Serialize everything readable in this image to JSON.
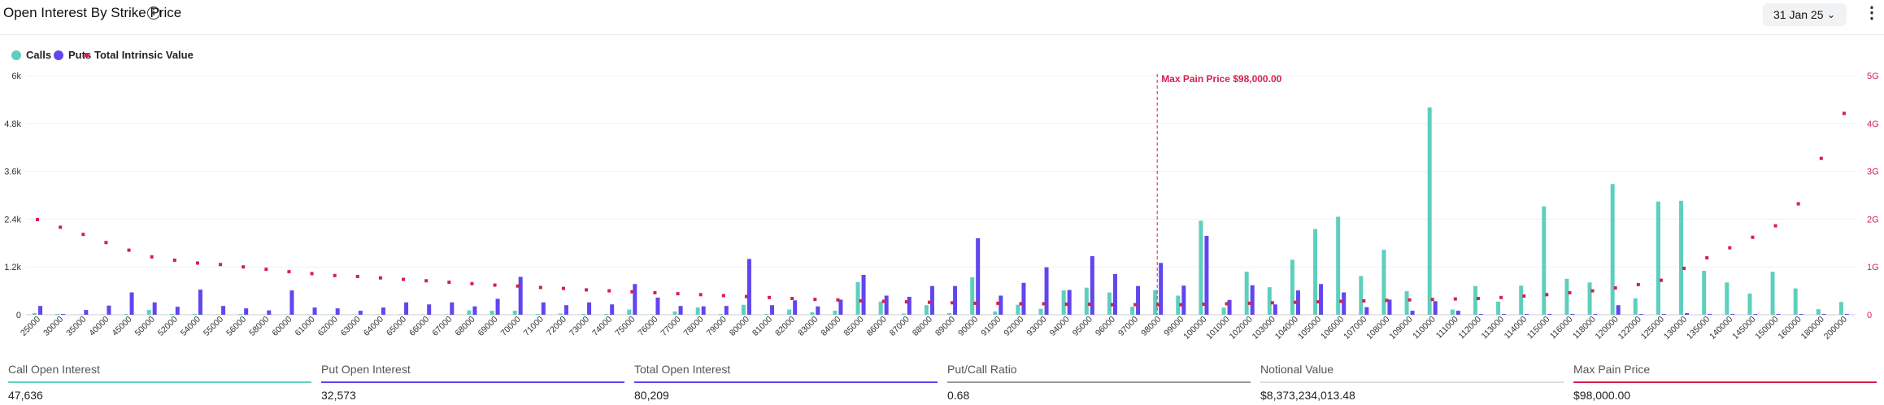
{
  "header": {
    "title": "Open Interest By Strike Price",
    "info_icon": "i",
    "date": "31 Jan 25",
    "chevron_icon": "⌄",
    "more_icon": "⋮"
  },
  "legend": [
    {
      "label": "Calls",
      "color": "#5ecfbd",
      "shape": "circle"
    },
    {
      "label": "Puts",
      "color": "#6146ee",
      "shape": "circle"
    },
    {
      "label": "Total Intrinsic Value",
      "color": "#d61f4f",
      "shape": "square"
    }
  ],
  "stats": [
    {
      "label": "Call Open Interest",
      "value": "47,636",
      "color": "#5ecfbd"
    },
    {
      "label": "Put Open Interest",
      "value": "32,573",
      "color": "#6146ee"
    },
    {
      "label": "Total Open Interest",
      "value": "80,209",
      "color": "#6146ee"
    },
    {
      "label": "Put/Call Ratio",
      "value": "0.68",
      "color": "#999999"
    },
    {
      "label": "Notional Value",
      "value": "$8,373,234,013.48",
      "color": "#dddddd"
    },
    {
      "label": "Max Pain Price",
      "value": "$98,000.00",
      "color": "#d61f4f"
    }
  ],
  "chart_data": {
    "type": "bar",
    "categories": [
      "25000",
      "30000",
      "35000",
      "40000",
      "45000",
      "50000",
      "52000",
      "54000",
      "55000",
      "56000",
      "58000",
      "60000",
      "61000",
      "62000",
      "63000",
      "64000",
      "65000",
      "66000",
      "67000",
      "68000",
      "69000",
      "70000",
      "71000",
      "72000",
      "73000",
      "74000",
      "75000",
      "76000",
      "77000",
      "78000",
      "79000",
      "80000",
      "81000",
      "82000",
      "83000",
      "84000",
      "85000",
      "86000",
      "87000",
      "88000",
      "89000",
      "90000",
      "91000",
      "92000",
      "93000",
      "94000",
      "95000",
      "96000",
      "97000",
      "98000",
      "99000",
      "100000",
      "101000",
      "102000",
      "103000",
      "104000",
      "105000",
      "106000",
      "107000",
      "108000",
      "109000",
      "110000",
      "111000",
      "112000",
      "113000",
      "114000",
      "115000",
      "116000",
      "118000",
      "120000",
      "122000",
      "125000",
      "130000",
      "135000",
      "140000",
      "145000",
      "150000",
      "160000",
      "180000",
      "200000"
    ],
    "series": [
      {
        "name": "Calls",
        "axis": "left",
        "values": [
          40,
          20,
          10,
          10,
          20,
          120,
          20,
          20,
          10,
          20,
          10,
          10,
          10,
          10,
          10,
          10,
          10,
          10,
          10,
          110,
          100,
          100,
          20,
          30,
          20,
          20,
          130,
          10,
          80,
          180,
          20,
          250,
          20,
          130,
          60,
          100,
          820,
          330,
          30,
          240,
          40,
          940,
          80,
          250,
          150,
          610,
          680,
          560,
          200,
          620,
          480,
          2360,
          180,
          1080,
          690,
          1380,
          2150,
          2460,
          970,
          1630,
          590,
          5200,
          130,
          720,
          330,
          730,
          2720,
          900,
          810,
          3280,
          410,
          2840,
          2860,
          1100,
          810,
          530,
          1080,
          660,
          140,
          320
        ]
      },
      {
        "name": "Puts",
        "axis": "left",
        "values": [
          220,
          20,
          120,
          230,
          560,
          310,
          200,
          630,
          220,
          160,
          110,
          610,
          180,
          160,
          100,
          180,
          310,
          260,
          310,
          210,
          400,
          950,
          310,
          240,
          310,
          260,
          770,
          430,
          220,
          210,
          220,
          1400,
          240,
          360,
          210,
          380,
          1000,
          480,
          450,
          720,
          720,
          1920,
          480,
          800,
          1190,
          620,
          1470,
          1020,
          720,
          1300,
          730,
          1980,
          370,
          740,
          260,
          610,
          770,
          560,
          190,
          380,
          100,
          340,
          100,
          20,
          20,
          20,
          20,
          20,
          20,
          240,
          20,
          20,
          40,
          20,
          20,
          20,
          20,
          20,
          20,
          20
        ]
      },
      {
        "name": "Total Intrinsic Value",
        "axis": "right",
        "values": [
          1.99,
          1.83,
          1.68,
          1.51,
          1.35,
          1.21,
          1.14,
          1.08,
          1.05,
          1.0,
          0.95,
          0.9,
          0.86,
          0.82,
          0.8,
          0.77,
          0.74,
          0.71,
          0.68,
          0.65,
          0.62,
          0.6,
          0.57,
          0.55,
          0.52,
          0.5,
          0.48,
          0.46,
          0.44,
          0.42,
          0.4,
          0.38,
          0.36,
          0.34,
          0.32,
          0.31,
          0.29,
          0.28,
          0.27,
          0.26,
          0.25,
          0.24,
          0.24,
          0.23,
          0.23,
          0.22,
          0.22,
          0.21,
          0.21,
          0.21,
          0.21,
          0.22,
          0.23,
          0.24,
          0.25,
          0.26,
          0.27,
          0.28,
          0.29,
          0.3,
          0.31,
          0.32,
          0.33,
          0.34,
          0.36,
          0.39,
          0.42,
          0.46,
          0.5,
          0.56,
          0.63,
          0.72,
          0.97,
          1.19,
          1.4,
          1.62,
          1.86,
          2.32,
          3.27,
          4.21
        ]
      }
    ],
    "y_left": {
      "ticks": [
        "0",
        "1.2k",
        "2.4k",
        "3.6k",
        "4.8k",
        "6k"
      ],
      "ylim": [
        0,
        6000
      ]
    },
    "y_right": {
      "ticks": [
        "0",
        "1G",
        "2G",
        "3G",
        "4G",
        "5G"
      ],
      "ylim": [
        0,
        5
      ]
    },
    "annotation": {
      "label": "Max Pain Price $98,000.00",
      "category": "98000"
    },
    "grid": true,
    "legend_position": "top-left"
  }
}
